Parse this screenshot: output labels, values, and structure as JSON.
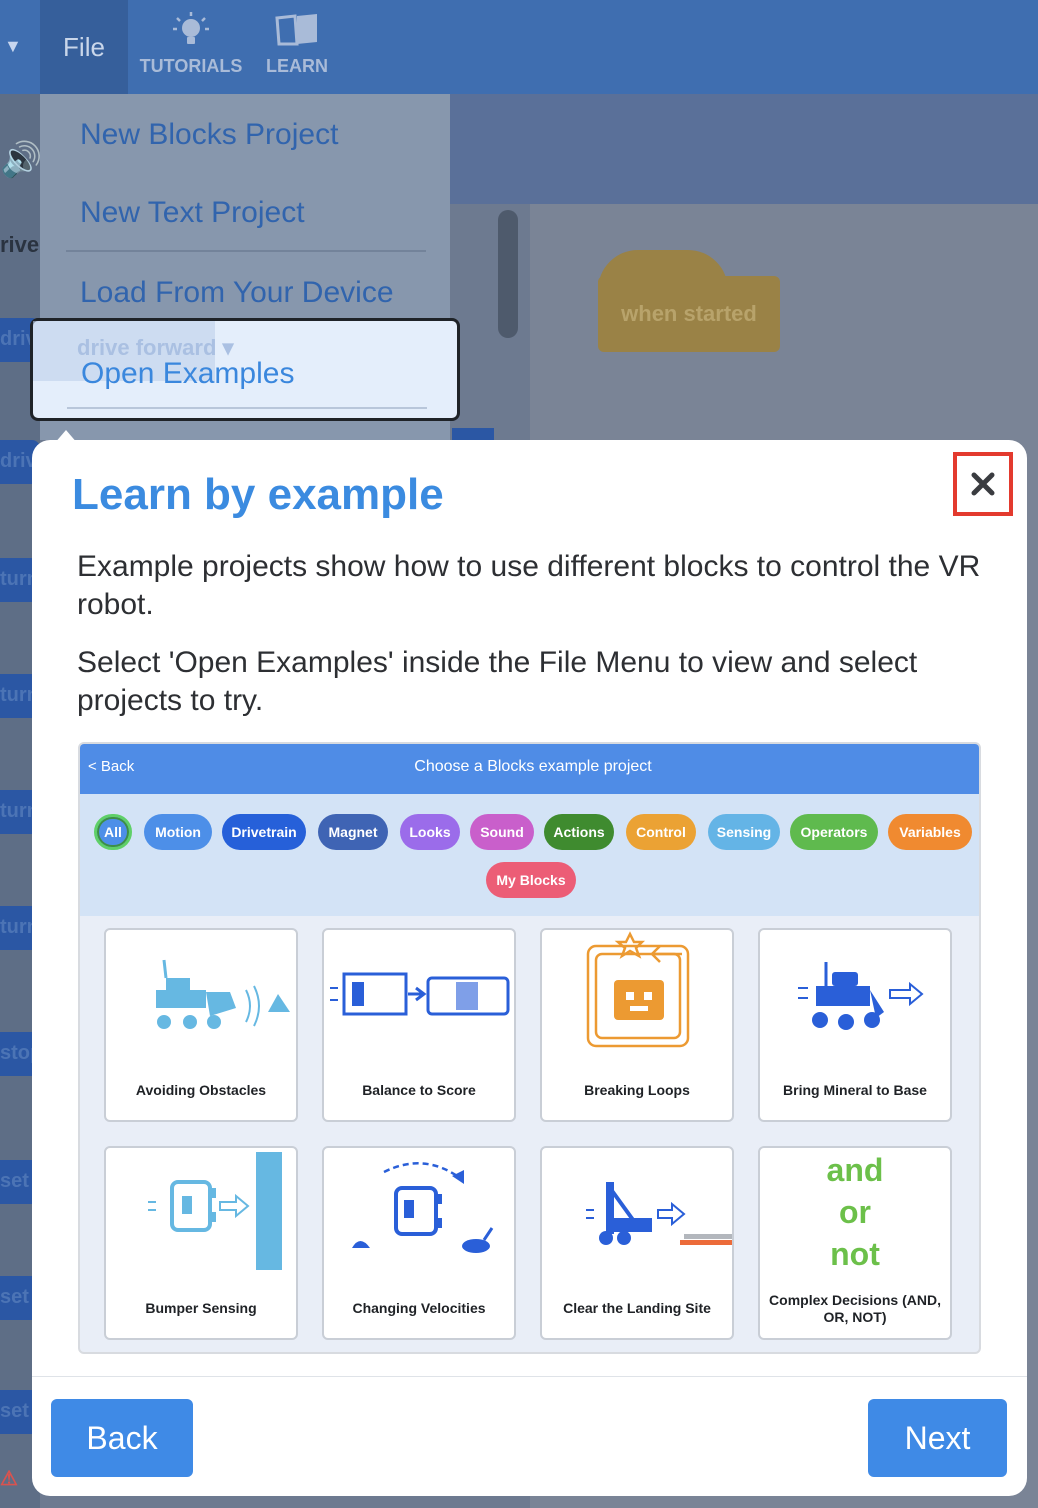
{
  "topbar": {
    "file_label": "File",
    "tutorials_label": "TUTORIALS",
    "learn_label": "LEARN"
  },
  "file_menu": {
    "items": [
      {
        "label": "New Blocks Project"
      },
      {
        "label": "New Text Project"
      },
      {
        "label": "Load From Your Device"
      },
      {
        "label": "Open Examples"
      }
    ]
  },
  "background": {
    "when_started": "when started",
    "ghost_block": "forward",
    "side_labels": [
      "drive",
      "drive",
      "drive",
      "turn",
      "turn",
      "turn",
      "turn",
      "stop",
      "set",
      "set",
      "set"
    ]
  },
  "modal": {
    "title": "Learn by example",
    "paragraph1": "Example projects show how to use different blocks to control the VR robot.",
    "paragraph2": "Select 'Open Examples' inside the File Menu to view and select projects to try.",
    "back_label": "Back",
    "next_label": "Next",
    "preview": {
      "back": "< Back",
      "title": "Choose a Blocks example project",
      "filters": [
        {
          "label": "All",
          "color": "#4d8fe8"
        },
        {
          "label": "Motion",
          "color": "#4d8fe8"
        },
        {
          "label": "Drivetrain",
          "color": "#2660d9"
        },
        {
          "label": "Magnet",
          "color": "#3f64b4"
        },
        {
          "label": "Looks",
          "color": "#9b6cea"
        },
        {
          "label": "Sound",
          "color": "#c95fcb"
        },
        {
          "label": "Actions",
          "color": "#3f8b2f"
        },
        {
          "label": "Control",
          "color": "#eba234"
        },
        {
          "label": "Sensing",
          "color": "#64b4e6"
        },
        {
          "label": "Operators",
          "color": "#5fba4e"
        },
        {
          "label": "Variables",
          "color": "#f08a30"
        },
        {
          "label": "My Blocks",
          "color": "#ec5d76"
        }
      ],
      "projects": [
        {
          "title": "Avoiding Obstacles",
          "icon": "rover-obstacle-icon"
        },
        {
          "title": "Balance to Score",
          "icon": "balance-icon"
        },
        {
          "title": "Breaking Loops",
          "icon": "loop-robot-icon"
        },
        {
          "title": "Bring Mineral to Base",
          "icon": "rover-mineral-icon"
        },
        {
          "title": "Bumper Sensing",
          "icon": "bumper-robot-icon"
        },
        {
          "title": "Changing Velocities",
          "icon": "velocity-robot-icon"
        },
        {
          "title": "Clear the Landing Site",
          "icon": "landing-site-icon"
        },
        {
          "title": "Complex Decisions (AND, OR, NOT)",
          "icon": "logic-words-icon",
          "words": [
            "and",
            "or",
            "not"
          ]
        }
      ]
    }
  },
  "colors": {
    "accent": "#3f8ae6",
    "title": "#3b8be0",
    "close_highlight": "#e33a2e"
  }
}
